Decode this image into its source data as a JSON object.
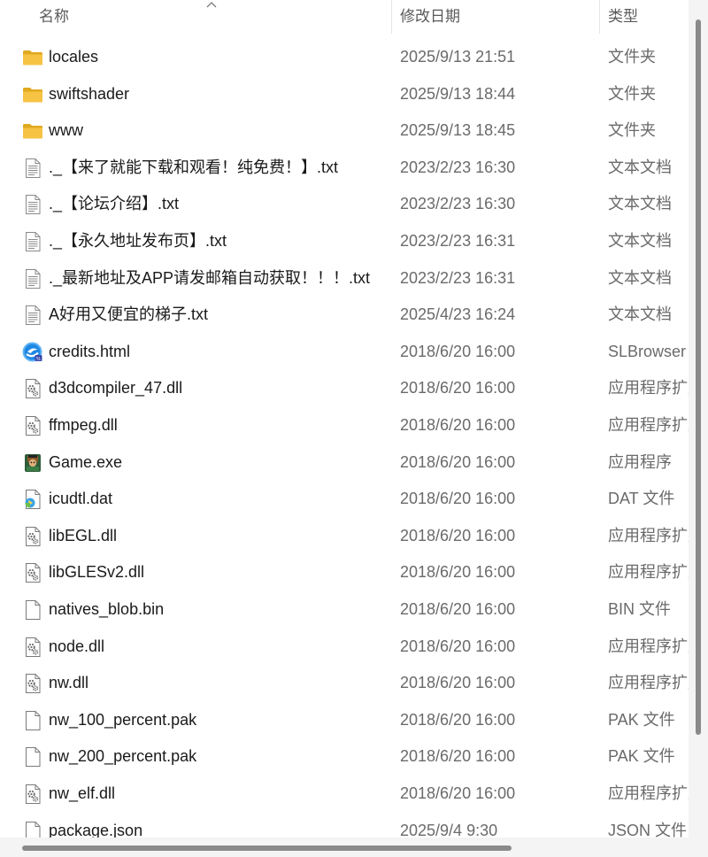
{
  "columns": {
    "name": "名称",
    "date": "修改日期",
    "type": "类型"
  },
  "colors": {
    "folder": "#f6c343",
    "folder_dark": "#e0a91f",
    "accent": "#0067c0"
  },
  "files": [
    {
      "name": "locales",
      "date": "2025/9/13 21:51",
      "type": "文件夹",
      "icon": "folder-icon"
    },
    {
      "name": "swiftshader",
      "date": "2025/9/13 18:44",
      "type": "文件夹",
      "icon": "folder-icon"
    },
    {
      "name": "www",
      "date": "2025/9/13 18:45",
      "type": "文件夹",
      "icon": "folder-icon"
    },
    {
      "name": "._【来了就能下载和观看！纯免费！】.txt",
      "date": "2023/2/23 16:30",
      "type": "文本文档",
      "icon": "text-file-icon"
    },
    {
      "name": "._【论坛介绍】.txt",
      "date": "2023/2/23 16:30",
      "type": "文本文档",
      "icon": "text-file-icon"
    },
    {
      "name": "._【永久地址发布页】.txt",
      "date": "2023/2/23 16:31",
      "type": "文本文档",
      "icon": "text-file-icon"
    },
    {
      "name": "._最新地址及APP请发邮箱自动获取！！！.txt",
      "date": "2023/2/23 16:31",
      "type": "文本文档",
      "icon": "text-file-icon"
    },
    {
      "name": "A好用又便宜的梯子.txt",
      "date": "2025/4/23 16:24",
      "type": "文本文档",
      "icon": "text-file-icon"
    },
    {
      "name": "credits.html",
      "date": "2018/6/20 16:00",
      "type": "SLBrowser",
      "icon": "browser-icon"
    },
    {
      "name": "d3dcompiler_47.dll",
      "date": "2018/6/20 16:00",
      "type": "应用程序扩展",
      "icon": "dll-file-icon"
    },
    {
      "name": "ffmpeg.dll",
      "date": "2018/6/20 16:00",
      "type": "应用程序扩展",
      "icon": "dll-file-icon"
    },
    {
      "name": "Game.exe",
      "date": "2018/6/20 16:00",
      "type": "应用程序",
      "icon": "game-exe-icon"
    },
    {
      "name": "icudtl.dat",
      "date": "2018/6/20 16:00",
      "type": "DAT 文件",
      "icon": "media-file-icon"
    },
    {
      "name": "libEGL.dll",
      "date": "2018/6/20 16:00",
      "type": "应用程序扩展",
      "icon": "dll-file-icon"
    },
    {
      "name": "libGLESv2.dll",
      "date": "2018/6/20 16:00",
      "type": "应用程序扩展",
      "icon": "dll-file-icon"
    },
    {
      "name": "natives_blob.bin",
      "date": "2018/6/20 16:00",
      "type": "BIN 文件",
      "icon": "blank-file-icon"
    },
    {
      "name": "node.dll",
      "date": "2018/6/20 16:00",
      "type": "应用程序扩展",
      "icon": "dll-file-icon"
    },
    {
      "name": "nw.dll",
      "date": "2018/6/20 16:00",
      "type": "应用程序扩展",
      "icon": "dll-file-icon"
    },
    {
      "name": "nw_100_percent.pak",
      "date": "2018/6/20 16:00",
      "type": "PAK 文件",
      "icon": "blank-file-icon"
    },
    {
      "name": "nw_200_percent.pak",
      "date": "2018/6/20 16:00",
      "type": "PAK 文件",
      "icon": "blank-file-icon"
    },
    {
      "name": "nw_elf.dll",
      "date": "2018/6/20 16:00",
      "type": "应用程序扩展",
      "icon": "dll-file-icon"
    },
    {
      "name": "package.json",
      "date": "2025/9/4 9:30",
      "type": "JSON 文件",
      "icon": "blank-file-icon"
    }
  ]
}
